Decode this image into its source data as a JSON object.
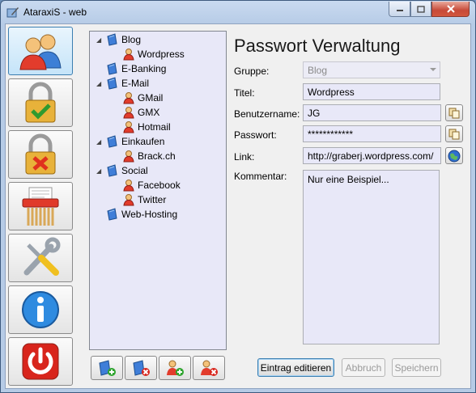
{
  "window": {
    "title": "AtaraxiS - web"
  },
  "nav": [
    {
      "name": "users-icon"
    },
    {
      "name": "lock-check-icon"
    },
    {
      "name": "lock-cross-icon"
    },
    {
      "name": "shredder-icon"
    },
    {
      "name": "tools-icon"
    },
    {
      "name": "info-icon"
    },
    {
      "name": "power-icon"
    }
  ],
  "tree": [
    {
      "label": "Blog",
      "kind": "group",
      "level": 0,
      "expanded": true
    },
    {
      "label": "Wordpress",
      "kind": "account",
      "level": 1
    },
    {
      "label": "E-Banking",
      "kind": "group",
      "level": 0
    },
    {
      "label": "E-Mail",
      "kind": "group",
      "level": 0,
      "expanded": true
    },
    {
      "label": "GMail",
      "kind": "account",
      "level": 1
    },
    {
      "label": "GMX",
      "kind": "account",
      "level": 1
    },
    {
      "label": "Hotmail",
      "kind": "account",
      "level": 1
    },
    {
      "label": "Einkaufen",
      "kind": "group",
      "level": 0,
      "expanded": true
    },
    {
      "label": "Brack.ch",
      "kind": "account",
      "level": 1
    },
    {
      "label": "Social",
      "kind": "group",
      "level": 0,
      "expanded": true
    },
    {
      "label": "Facebook",
      "kind": "account",
      "level": 1
    },
    {
      "label": "Twitter",
      "kind": "account",
      "level": 1
    },
    {
      "label": "Web-Hosting",
      "kind": "group",
      "level": 0
    }
  ],
  "form": {
    "heading": "Passwort Verwaltung",
    "labels": {
      "group": "Gruppe:",
      "title": "Titel:",
      "username": "Benutzername:",
      "password": "Passwort:",
      "link": "Link:",
      "comment": "Kommentar:"
    },
    "values": {
      "group": "Blog",
      "title": "Wordpress",
      "username": "JG",
      "password": "************",
      "link": "http://graberj.wordpress.com/",
      "comment": "Nur eine Beispiel..."
    }
  },
  "buttons": {
    "edit": "Eintrag editieren",
    "cancel": "Abbruch",
    "save": "Speichern"
  },
  "colors": {
    "accent": "#3c7fb1",
    "field_bg": "#e8e8f8"
  }
}
